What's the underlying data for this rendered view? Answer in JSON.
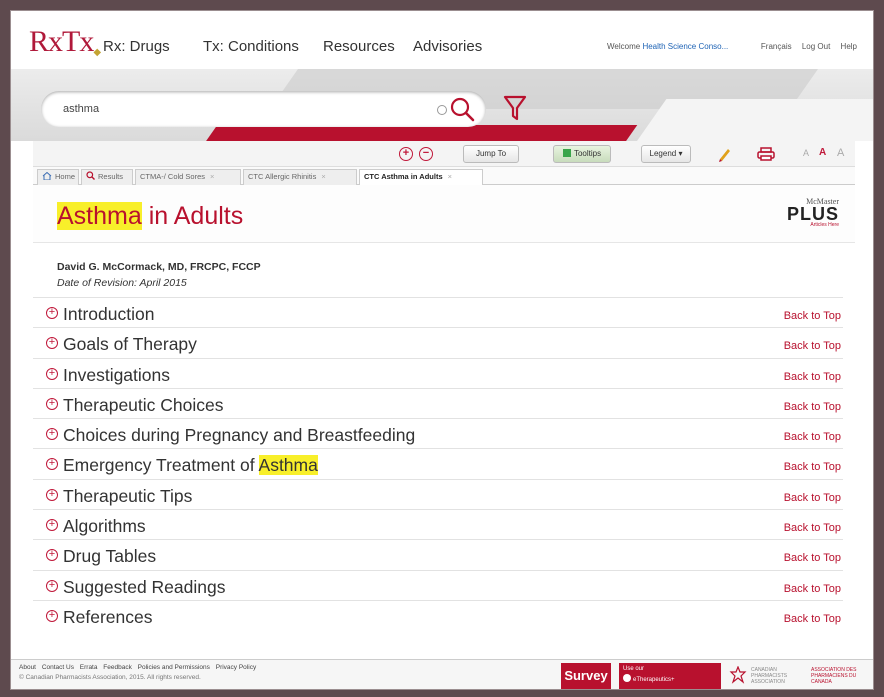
{
  "nav": {
    "logo": "RxTx",
    "items": [
      "Rx: Drugs",
      "Tx: Conditions",
      "Resources",
      "Advisories"
    ],
    "welcome": "Welcome",
    "user": "Health Science Conso...",
    "links": [
      "Français",
      "Log Out",
      "Help"
    ]
  },
  "search": {
    "value": "asthma"
  },
  "toolbar": {
    "jump_to": "Jump To",
    "tooltips": "Tooltips",
    "legend": "Legend",
    "font_sizes": [
      "A",
      "A",
      "A"
    ]
  },
  "tabs": [
    {
      "label": "Home"
    },
    {
      "label": "Results"
    },
    {
      "label": "CTMA-/ Cold Sores"
    },
    {
      "label": "CTC Allergic Rhinitis"
    },
    {
      "label": "CTC Asthma in Adults"
    }
  ],
  "document": {
    "title_highlight": "Asthma",
    "title_rest": " in Adults",
    "author": "David G. McCormack, MD, FRCPC, FCCP",
    "revision": "Date of Revision: April 2015",
    "partner": {
      "line1": "McMaster",
      "line2": "PLUS",
      "line3": "Articles Here"
    },
    "back_to_top": "Back to Top",
    "sections": [
      {
        "pre": "Introduction",
        "hl": "",
        "post": ""
      },
      {
        "pre": "Goals of Therapy",
        "hl": "",
        "post": ""
      },
      {
        "pre": "Investigations",
        "hl": "",
        "post": ""
      },
      {
        "pre": "Therapeutic Choices",
        "hl": "",
        "post": ""
      },
      {
        "pre": "Choices during Pregnancy and Breastfeeding",
        "hl": "",
        "post": ""
      },
      {
        "pre": "Emergency Treatment of ",
        "hl": "Asthma",
        "post": ""
      },
      {
        "pre": "Therapeutic Tips",
        "hl": "",
        "post": ""
      },
      {
        "pre": "Algorithms",
        "hl": "",
        "post": ""
      },
      {
        "pre": "Drug Tables",
        "hl": "",
        "post": ""
      },
      {
        "pre": "Suggested Readings",
        "hl": "",
        "post": ""
      },
      {
        "pre": "References",
        "hl": "",
        "post": ""
      }
    ]
  },
  "footer": {
    "links": [
      "About",
      "Contact Us",
      "Errata",
      "Feedback",
      "Policies and Permissions",
      "Privacy Policy"
    ],
    "copyright": "© Canadian Pharmacists Association, 2015. All rights reserved.",
    "survey": "Survey",
    "use_cps": "Use our",
    "cps_brand": "eTherapeutics+",
    "cpha_en": "CANADIAN PHARMACISTS ASSOCIATION",
    "cpha_fr": "ASSOCIATION DES PHARMACIENS DU CANADA"
  },
  "colors": {
    "brand": "#b8112e",
    "highlight": "#f8ef2a"
  }
}
